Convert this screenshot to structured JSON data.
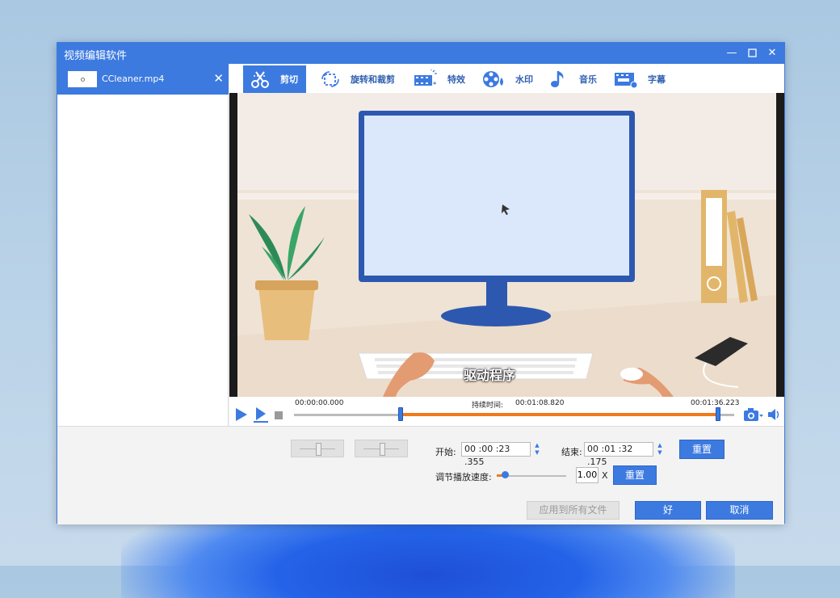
{
  "window": {
    "title": "视频编辑软件"
  },
  "file": {
    "name": "CCleaner.mp4"
  },
  "tabs": [
    {
      "label": "剪切",
      "icon": "scissors-icon"
    },
    {
      "label": "旋转和裁剪",
      "icon": "crop-rotate-icon"
    },
    {
      "label": "特效",
      "icon": "film-effects-icon"
    },
    {
      "label": "水印",
      "icon": "watermark-reel-icon"
    },
    {
      "label": "音乐",
      "icon": "music-note-icon"
    },
    {
      "label": "字幕",
      "icon": "subtitle-icon"
    }
  ],
  "preview": {
    "subtitle": "驱动程序"
  },
  "timeline": {
    "start_time": "00:00:00.000",
    "duration_label": "持续时间:",
    "duration": "00:01:08.820",
    "end_time": "00:01:36.223",
    "selection_start_fraction": 0.243,
    "selection_end_fraction": 0.963
  },
  "trim": {
    "start_label": "开始:",
    "start_value": "00 :00 :23 .355",
    "end_label": "结束:",
    "end_value": "00 :01 :32 .175",
    "reset_label": "重置"
  },
  "speed": {
    "label": "调节播放速度:",
    "value": "1.00",
    "unit": "X",
    "reset_label": "重置",
    "slider_fraction": 0.12
  },
  "footer": {
    "apply_all_label": "应用到所有文件",
    "ok_label": "好",
    "cancel_label": "取消"
  },
  "colors": {
    "accent": "#3c7ae0",
    "selection": "#f07a1a"
  }
}
